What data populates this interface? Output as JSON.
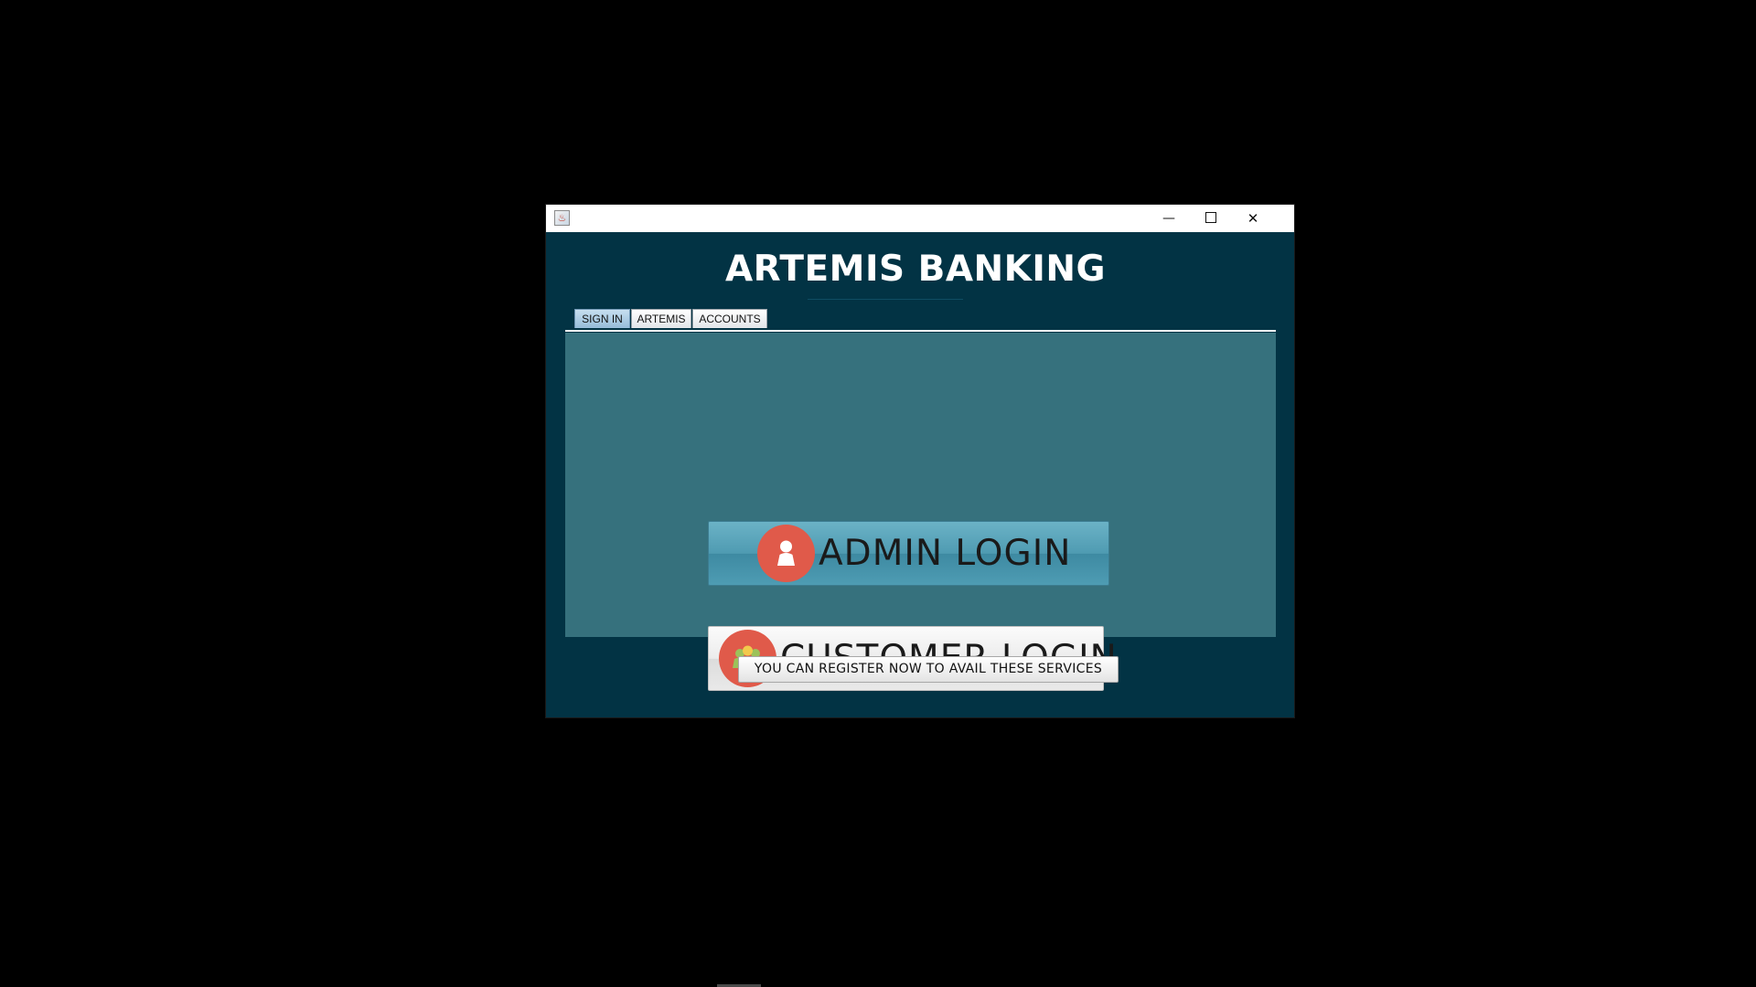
{
  "window": {
    "title": ""
  },
  "app": {
    "title": "ARTEMIS BANKING"
  },
  "tabs": [
    {
      "label": "SIGN IN",
      "active": true
    },
    {
      "label": "ARTEMIS",
      "active": false
    },
    {
      "label": "ACCOUNTS",
      "active": false
    }
  ],
  "sign_in": {
    "admin_label": "ADMIN LOGIN",
    "admin_icon": "user-icon",
    "customer_label": "CUSTOMER LOGIN",
    "customer_icon": "users-icon"
  },
  "register": {
    "label": "YOU CAN REGISTER NOW TO AVAIL THESE SERVICES"
  },
  "colors": {
    "window_bg": "#023344",
    "panel_bg": "#36717d",
    "icon_circle": "#e05a4a",
    "admin_button": "#4f9bb2",
    "customer_button": "#ececec"
  }
}
